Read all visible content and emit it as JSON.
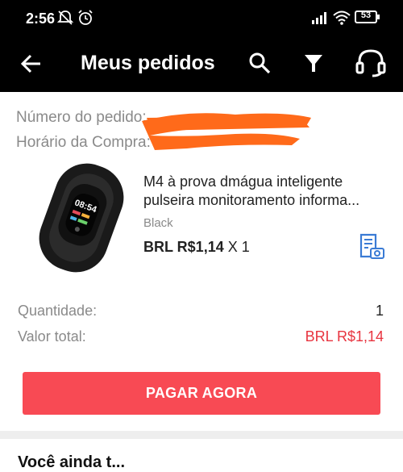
{
  "status": {
    "time": "2:56",
    "battery": "53"
  },
  "appbar": {
    "title": "Meus pedidos"
  },
  "order": {
    "number_label": "Número do pedido:",
    "time_label": "Horário da Compra:"
  },
  "product": {
    "title_line1": "M4 à prova dmágua inteligente",
    "title_line2": "pulseira monitoramento informa...",
    "variant": "Black",
    "price": "BRL R$1,14",
    "qty_text": " X 1",
    "watch_time": "08:54"
  },
  "summary": {
    "quantity_label": "Quantidade:",
    "quantity_value": "1",
    "total_label": "Valor total:",
    "total_value": "BRL R$1,14"
  },
  "actions": {
    "pay_label": "PAGAR AGORA"
  },
  "next_section": {
    "title": "Você ainda t..."
  },
  "colors": {
    "accent": "#f84a54",
    "price_red": "#e8343f",
    "redaction": "#ff6a1a",
    "icon_blue": "#3a7bd5"
  },
  "icons": [
    "back-arrow-icon",
    "search-icon",
    "filter-icon",
    "headset-icon",
    "invoice-icon",
    "notifications-off-icon",
    "alarm-icon",
    "signal-icon",
    "wifi-icon",
    "battery-icon"
  ]
}
